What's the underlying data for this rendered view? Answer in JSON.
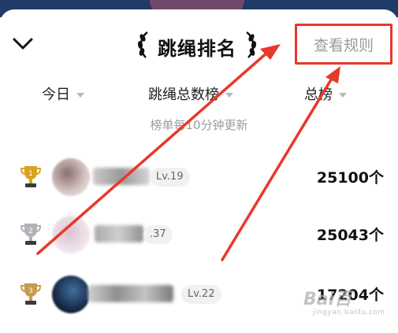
{
  "header": {
    "title": "跳绳排名",
    "rules_link": "查看规则"
  },
  "filters": [
    {
      "label": "今日"
    },
    {
      "label": "跳绳总数榜"
    },
    {
      "label": "总榜"
    }
  ],
  "subtitle": "榜单每10分钟更新",
  "ranking": [
    {
      "rank": "1",
      "level": "Lv.19",
      "score": "25100个"
    },
    {
      "rank": "2",
      "level": ".37",
      "score": "25043个"
    },
    {
      "rank": "3",
      "level": "Lv.22",
      "score": "17204个"
    }
  ],
  "watermark": {
    "logo": "Bai百",
    "sub": "jingyan.baidu.com"
  },
  "colors": {
    "accent_red": "#e8382b",
    "gold": "#d9a21d",
    "silver": "#b0b3b8",
    "bronze": "#c79b4a"
  }
}
